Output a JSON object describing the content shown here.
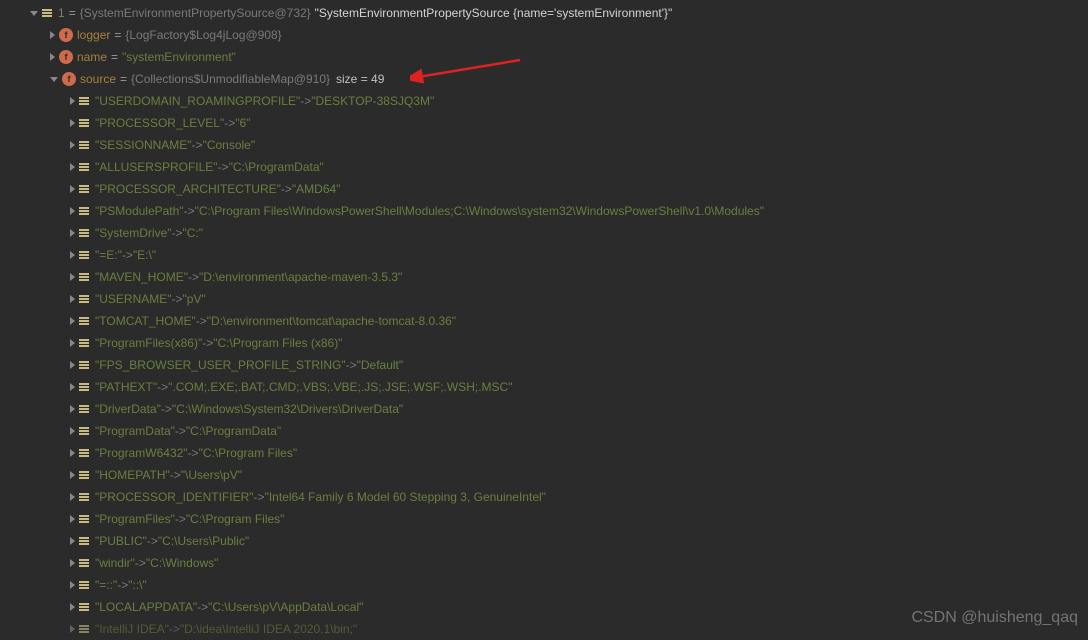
{
  "root": {
    "index": "1",
    "objref": "{SystemEnvironmentPropertySource@732}",
    "toString": "\"SystemEnvironmentPropertySource {name='systemEnvironment'}\""
  },
  "fields": {
    "logger": {
      "name": "logger",
      "value": "{LogFactory$Log4jLog@908}"
    },
    "name": {
      "name": "name",
      "value": "\"systemEnvironment\""
    },
    "source": {
      "name": "source",
      "value": "{Collections$UnmodifiableMap@910}",
      "size": "size = 49"
    }
  },
  "entries": [
    {
      "k": "\"USERDOMAIN_ROAMINGPROFILE\"",
      "v": "\"DESKTOP-38SJQ3M\""
    },
    {
      "k": "\"PROCESSOR_LEVEL\"",
      "v": "\"6\""
    },
    {
      "k": "\"SESSIONNAME\"",
      "v": "\"Console\""
    },
    {
      "k": "\"ALLUSERSPROFILE\"",
      "v": "\"C:\\ProgramData\""
    },
    {
      "k": "\"PROCESSOR_ARCHITECTURE\"",
      "v": "\"AMD64\""
    },
    {
      "k": "\"PSModulePath\"",
      "v": "\"C:\\Program Files\\WindowsPowerShell\\Modules;C:\\Windows\\system32\\WindowsPowerShell\\v1.0\\Modules\""
    },
    {
      "k": "\"SystemDrive\"",
      "v": "\"C:\""
    },
    {
      "k": "\"=E:\"",
      "v": "\"E:\\\""
    },
    {
      "k": "\"MAVEN_HOME\"",
      "v": "\"D:\\environment\\apache-maven-3.5.3\""
    },
    {
      "k": "\"USERNAME\"",
      "v": "\"pV\""
    },
    {
      "k": "\"TOMCAT_HOME\"",
      "v": "\"D:\\environment\\tomcat\\apache-tomcat-8.0.36\""
    },
    {
      "k": "\"ProgramFiles(x86)\"",
      "v": "\"C:\\Program Files (x86)\""
    },
    {
      "k": "\"FPS_BROWSER_USER_PROFILE_STRING\"",
      "v": "\"Default\""
    },
    {
      "k": "\"PATHEXT\"",
      "v": "\".COM;.EXE;.BAT;.CMD;.VBS;.VBE;.JS;.JSE;.WSF;.WSH;.MSC\""
    },
    {
      "k": "\"DriverData\"",
      "v": "\"C:\\Windows\\System32\\Drivers\\DriverData\""
    },
    {
      "k": "\"ProgramData\"",
      "v": "\"C:\\ProgramData\""
    },
    {
      "k": "\"ProgramW6432\"",
      "v": "\"C:\\Program Files\""
    },
    {
      "k": "\"HOMEPATH\"",
      "v": "\"\\Users\\pV\""
    },
    {
      "k": "\"PROCESSOR_IDENTIFIER\"",
      "v": "\"Intel64 Family 6 Model 60 Stepping 3, GenuineIntel\""
    },
    {
      "k": "\"ProgramFiles\"",
      "v": "\"C:\\Program Files\""
    },
    {
      "k": "\"PUBLIC\"",
      "v": "\"C:\\Users\\Public\""
    },
    {
      "k": "\"windir\"",
      "v": "\"C:\\Windows\""
    },
    {
      "k": "\"=::\"",
      "v": "\"::\\\""
    },
    {
      "k": "\"LOCALAPPDATA\"",
      "v": "\"C:\\Users\\pV\\AppData\\Local\""
    },
    {
      "k": "\"IntelliJ IDEA\"",
      "v": "\"D:\\idea\\IntelliJ IDEA 2020.1\\bin;\"",
      "dim": true
    }
  ],
  "arrowSep": " -> ",
  "watermark": "CSDN @huisheng_qaq"
}
